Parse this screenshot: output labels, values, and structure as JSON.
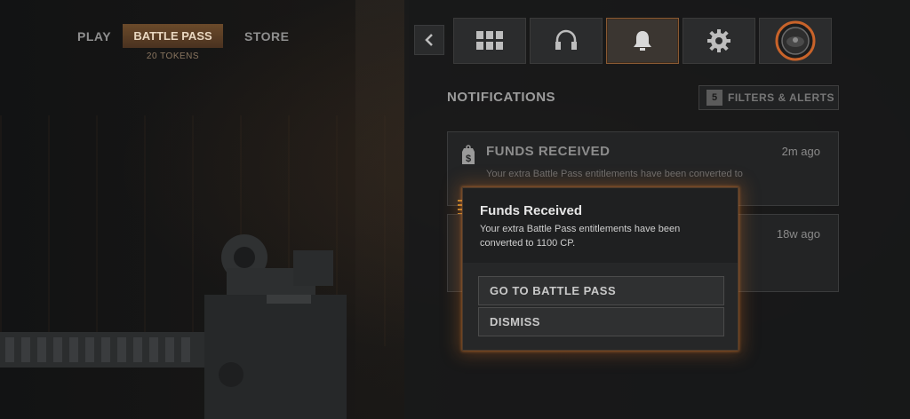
{
  "nav": {
    "play_label": "PLAY",
    "battle_pass_label": "BATTLE PASS",
    "tokens_label": "20 TOKENS",
    "store_label": "STORE"
  },
  "icon_bar": {
    "items": [
      {
        "icon": "back-chevron-icon"
      },
      {
        "icon": "grid-icon"
      },
      {
        "icon": "headset-icon"
      },
      {
        "icon": "bell-icon",
        "active": true
      },
      {
        "icon": "gear-icon"
      },
      {
        "icon": "profile-emblem-icon"
      }
    ],
    "accent_color": "#8a5a33"
  },
  "notifications": {
    "title": "NOTIFICATIONS",
    "filters_count": "5",
    "filters_label": "FILTERS & ALERTS",
    "cards": [
      {
        "icon": "dollar-tag-icon",
        "title": "FUNDS RECEIVED",
        "time": "2m ago",
        "body": "Your extra Battle Pass entitlements have been converted to"
      },
      {
        "time": "18w ago"
      }
    ]
  },
  "modal": {
    "title": "Funds Received",
    "body": "Your extra Battle Pass entitlements have been converted to 1100 CP.",
    "primary_button": "GO TO BATTLE PASS",
    "secondary_button": "DISMISS",
    "glow_color": "#c86e28"
  }
}
